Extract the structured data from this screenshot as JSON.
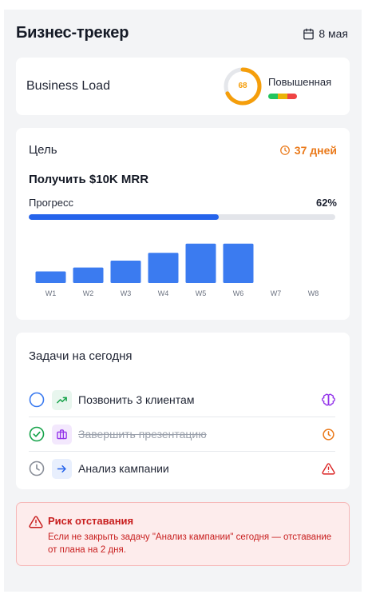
{
  "header": {
    "title": "Бизнес-трекер",
    "date": "8 мая"
  },
  "business_load": {
    "label": "Business Load",
    "value": 68,
    "value_text": "68",
    "level": "Повышенная",
    "ring_color": "#f59e0b",
    "level_colors": [
      "#22c55e",
      "#eab308",
      "#ef4444"
    ]
  },
  "goal": {
    "heading": "Цель",
    "days_left": "37 дней",
    "title": "Получить $10K MRR",
    "progress_label": "Прогресс",
    "progress_text": "62%",
    "progress_value": 0.62,
    "accent": "#2563eb"
  },
  "chart_data": {
    "type": "bar",
    "categories": [
      "W1",
      "W2",
      "W3",
      "W4",
      "W5",
      "W6",
      "W7",
      "W8"
    ],
    "values": [
      15,
      20,
      29,
      39,
      51,
      51,
      0,
      0
    ],
    "ylim": [
      0,
      60
    ],
    "grid": false,
    "color": "#3b7bf0"
  },
  "tasks": {
    "heading": "Задачи на сегодня",
    "items": [
      {
        "text": "Позвонить 3 клиентам",
        "status": "open",
        "category_icon": "trend-up-icon",
        "tag_icon": "brain-icon",
        "done": false
      },
      {
        "text": "Завершить презентацию",
        "status": "done",
        "category_icon": "briefcase-icon",
        "tag_icon": "clock-icon",
        "done": true
      },
      {
        "text": "Анализ кампании",
        "status": "waiting",
        "category_icon": "arrow-right-icon",
        "tag_icon": "warning-icon",
        "done": false
      }
    ]
  },
  "alert": {
    "title": "Риск отставания",
    "text": "Если не закрыть задачу \"Анализ кампании\" сегодня — отставание от плана на 2 дня.",
    "color": "#c81e1e"
  }
}
